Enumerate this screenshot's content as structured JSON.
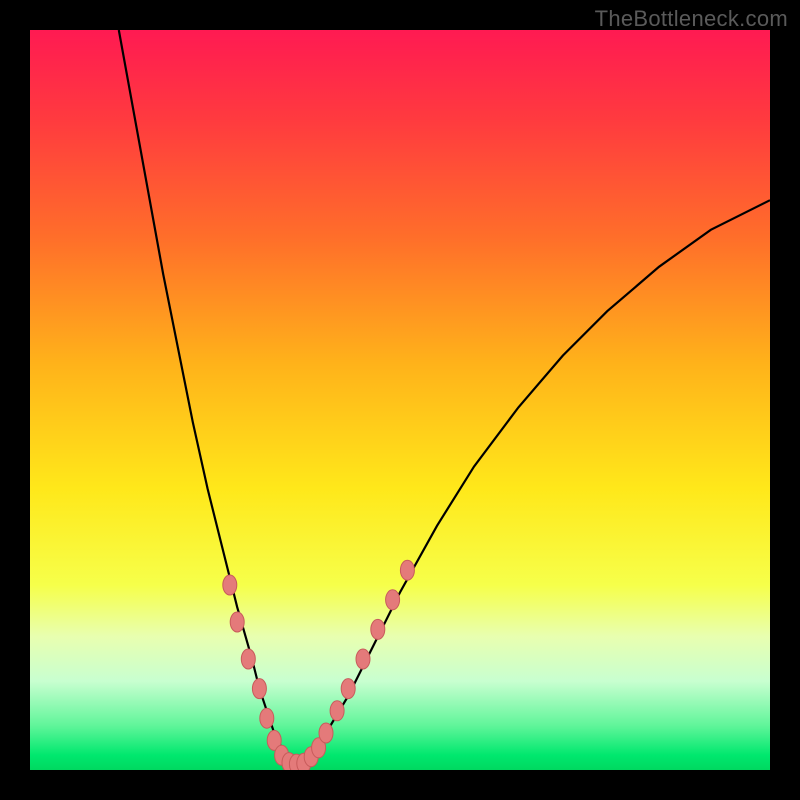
{
  "watermark": "TheBottleneck.com",
  "chart_data": {
    "type": "line",
    "title": "",
    "xlabel": "",
    "ylabel": "",
    "xlim": [
      0,
      100
    ],
    "ylim": [
      0,
      100
    ],
    "background_gradient": {
      "stops": [
        {
          "offset": 0.0,
          "color": "#ff1a52"
        },
        {
          "offset": 0.12,
          "color": "#ff3a3f"
        },
        {
          "offset": 0.28,
          "color": "#ff6e2a"
        },
        {
          "offset": 0.45,
          "color": "#ffb21a"
        },
        {
          "offset": 0.62,
          "color": "#ffe81a"
        },
        {
          "offset": 0.75,
          "color": "#f6ff4a"
        },
        {
          "offset": 0.82,
          "color": "#e8ffb0"
        },
        {
          "offset": 0.88,
          "color": "#c8ffd0"
        },
        {
          "offset": 0.94,
          "color": "#60f59a"
        },
        {
          "offset": 0.98,
          "color": "#00e86e"
        },
        {
          "offset": 1.0,
          "color": "#00d860"
        }
      ]
    },
    "series": [
      {
        "name": "left-curve",
        "stroke": "#000000",
        "x": [
          12,
          14,
          16,
          18,
          20,
          22,
          24,
          26,
          28,
          30,
          31,
          32,
          33,
          34,
          35,
          36
        ],
        "y": [
          100,
          89,
          78,
          67,
          57,
          47,
          38,
          30,
          22,
          15,
          11,
          8,
          5,
          3,
          1.5,
          0.5
        ]
      },
      {
        "name": "right-curve",
        "stroke": "#000000",
        "x": [
          36,
          38,
          40,
          43,
          46,
          50,
          55,
          60,
          66,
          72,
          78,
          85,
          92,
          100
        ],
        "y": [
          0.5,
          2,
          5,
          10,
          16,
          24,
          33,
          41,
          49,
          56,
          62,
          68,
          73,
          77
        ]
      }
    ],
    "markers": {
      "color": "#e47a7a",
      "stroke": "#c85b5b",
      "rx": 7,
      "ry": 10,
      "points_left": [
        [
          27,
          25
        ],
        [
          28,
          20
        ],
        [
          29.5,
          15
        ],
        [
          31,
          11
        ],
        [
          32,
          7
        ],
        [
          33,
          4
        ]
      ],
      "points_bottom": [
        [
          34,
          2
        ],
        [
          35,
          1
        ],
        [
          36,
          0.8
        ],
        [
          37,
          0.9
        ],
        [
          38,
          1.8
        ]
      ],
      "points_right": [
        [
          39,
          3
        ],
        [
          40,
          5
        ],
        [
          41.5,
          8
        ],
        [
          43,
          11
        ],
        [
          45,
          15
        ],
        [
          47,
          19
        ],
        [
          49,
          23
        ],
        [
          51,
          27
        ]
      ]
    }
  }
}
